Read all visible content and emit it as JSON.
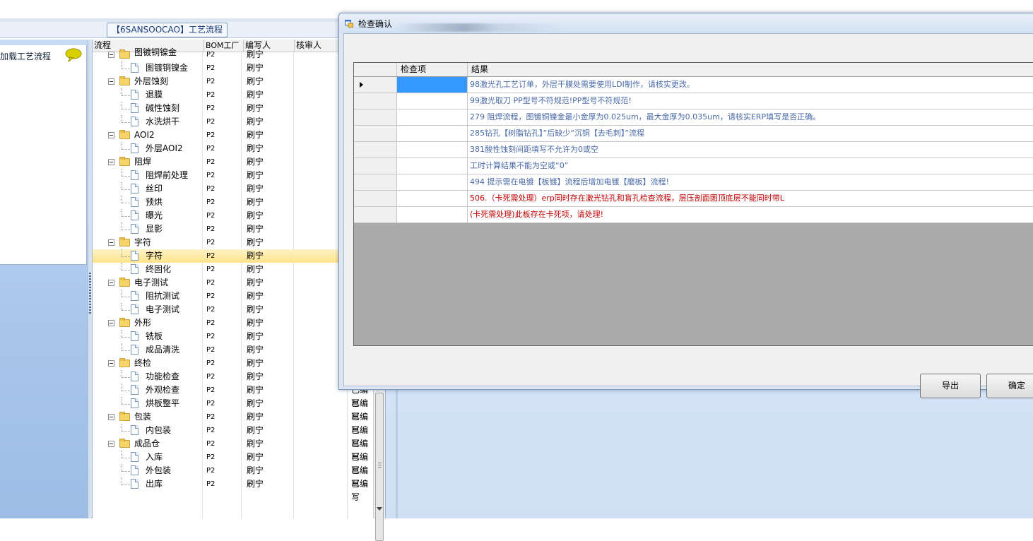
{
  "group_title": "【6SANSOOCAO】工艺流程",
  "left_panel": {
    "load_link": "加载工艺流程",
    "chat_icon": "speech-bubble-icon"
  },
  "tree": {
    "columns": [
      "流程",
      "BOM工厂",
      "编写人",
      "核审人"
    ],
    "rows": [
      {
        "name": "图镀铜镍金",
        "level": 0,
        "folder": true,
        "factory": "P2",
        "writer": "刷宁",
        "status": "",
        "partial": true
      },
      {
        "name": "图镀铜镍金",
        "level": 1,
        "folder": false,
        "factory": "P2",
        "writer": "刷宁",
        "status": ""
      },
      {
        "name": "外层蚀刻",
        "level": 0,
        "folder": true,
        "factory": "P2",
        "writer": "刷宁",
        "status": ""
      },
      {
        "name": "退膜",
        "level": 1,
        "folder": false,
        "factory": "P2",
        "writer": "刷宁",
        "status": ""
      },
      {
        "name": "碱性蚀刻",
        "level": 1,
        "folder": false,
        "factory": "P2",
        "writer": "刷宁",
        "status": ""
      },
      {
        "name": "水洗烘干",
        "level": 1,
        "folder": false,
        "factory": "P2",
        "writer": "刷宁",
        "status": ""
      },
      {
        "name": "AOI2",
        "level": 0,
        "folder": true,
        "factory": "P2",
        "writer": "刷宁",
        "status": ""
      },
      {
        "name": "外层AOI2",
        "level": 1,
        "folder": false,
        "factory": "P2",
        "writer": "刷宁",
        "status": ""
      },
      {
        "name": "阻焊",
        "level": 0,
        "folder": true,
        "factory": "P2",
        "writer": "刷宁",
        "status": ""
      },
      {
        "name": "阻焊前处理",
        "level": 1,
        "folder": false,
        "factory": "P2",
        "writer": "刷宁",
        "status": ""
      },
      {
        "name": "丝印",
        "level": 1,
        "folder": false,
        "factory": "P2",
        "writer": "刷宁",
        "status": ""
      },
      {
        "name": "预烘",
        "level": 1,
        "folder": false,
        "factory": "P2",
        "writer": "刷宁",
        "status": ""
      },
      {
        "name": "曝光",
        "level": 1,
        "folder": false,
        "factory": "P2",
        "writer": "刷宁",
        "status": ""
      },
      {
        "name": "显影",
        "level": 1,
        "folder": false,
        "factory": "P2",
        "writer": "刷宁",
        "status": ""
      },
      {
        "name": "字符",
        "level": 0,
        "folder": true,
        "factory": "P2",
        "writer": "刷宁",
        "status": ""
      },
      {
        "name": "字符",
        "level": 1,
        "folder": false,
        "factory": "P2",
        "writer": "刷宁",
        "status": "",
        "selected": true
      },
      {
        "name": "终固化",
        "level": 1,
        "folder": false,
        "factory": "P2",
        "writer": "刷宁",
        "status": ""
      },
      {
        "name": "电子测试",
        "level": 0,
        "folder": true,
        "factory": "P2",
        "writer": "刷宁",
        "status": ""
      },
      {
        "name": "阻抗测试",
        "level": 1,
        "folder": false,
        "factory": "P2",
        "writer": "刷宁",
        "status": ""
      },
      {
        "name": "电子测试",
        "level": 1,
        "folder": false,
        "factory": "P2",
        "writer": "刷宁",
        "status": ""
      },
      {
        "name": "外形",
        "level": 0,
        "folder": true,
        "factory": "P2",
        "writer": "刷宁",
        "status": ""
      },
      {
        "name": "铣板",
        "level": 1,
        "folder": false,
        "factory": "P2",
        "writer": "刷宁",
        "status": ""
      },
      {
        "name": "成品清洗",
        "level": 1,
        "folder": false,
        "factory": "P2",
        "writer": "刷宁",
        "status": ""
      },
      {
        "name": "终检",
        "level": 0,
        "folder": true,
        "factory": "P2",
        "writer": "刷宁",
        "status": ""
      },
      {
        "name": "功能检查",
        "level": 1,
        "folder": false,
        "factory": "P2",
        "writer": "刷宁",
        "status": ""
      },
      {
        "name": "外观检查",
        "level": 1,
        "folder": false,
        "factory": "P2",
        "writer": "刷宁",
        "status": "已编写"
      },
      {
        "name": "烘板整平",
        "level": 1,
        "folder": false,
        "factory": "P2",
        "writer": "刷宁",
        "status": "已编写"
      },
      {
        "name": "包装",
        "level": 0,
        "folder": true,
        "factory": "P2",
        "writer": "刷宁",
        "status": "已编写"
      },
      {
        "name": "内包装",
        "level": 1,
        "folder": false,
        "factory": "P2",
        "writer": "刷宁",
        "status": "已编写"
      },
      {
        "name": "成品仓",
        "level": 0,
        "folder": true,
        "factory": "P2",
        "writer": "刷宁",
        "status": "已编写"
      },
      {
        "name": "入库",
        "level": 1,
        "folder": false,
        "factory": "P2",
        "writer": "刷宁",
        "status": "已编写"
      },
      {
        "name": "外包装",
        "level": 1,
        "folder": false,
        "factory": "P2",
        "writer": "刷宁",
        "status": "已编写"
      },
      {
        "name": "出库",
        "level": 1,
        "folder": false,
        "factory": "P2",
        "writer": "刷宁",
        "status": "已编写"
      }
    ]
  },
  "dialog": {
    "title": "检查确认",
    "columns": [
      "检查项",
      "结果"
    ],
    "rows": [
      {
        "item": "",
        "result": "98激光孔工艺订单，外层干膜处需要使用LDI制作，请核实更改。",
        "red": false
      },
      {
        "item": "",
        "result": "99激光取刀 PP型号不符规范!PP型号不符规范!",
        "red": false
      },
      {
        "item": "",
        "result": "279 阻焊流程，图镀铜镍金最小金厚为0.025um，最大金厚为0.035um，请核实ERP填写是否正确。",
        "red": false
      },
      {
        "item": "",
        "result": "285钻孔【树脂钻孔】”后缺少“沉铜【去毛刺】”流程",
        "red": false
      },
      {
        "item": "",
        "result": "381酸性蚀刻间距填写不允许为0或空",
        "red": false
      },
      {
        "item": "",
        "result": "工时计算结果不能为空或“0”",
        "red": false
      },
      {
        "item": "",
        "result": "494 提示需在电镀【板镀】流程后增加电镀【磨板】流程!",
        "red": false
      },
      {
        "item": "",
        "result": "506.（卡死需处理）erp同时存在激光钻孔和盲孔检查流程，层压剖面图顶底层不能同时带L",
        "red": true
      },
      {
        "item": "",
        "result": "(卡死需处理)此板存在卡死项，请处理!",
        "red": true
      }
    ],
    "buttons": {
      "export": "导出",
      "confirm": "确定"
    }
  }
}
